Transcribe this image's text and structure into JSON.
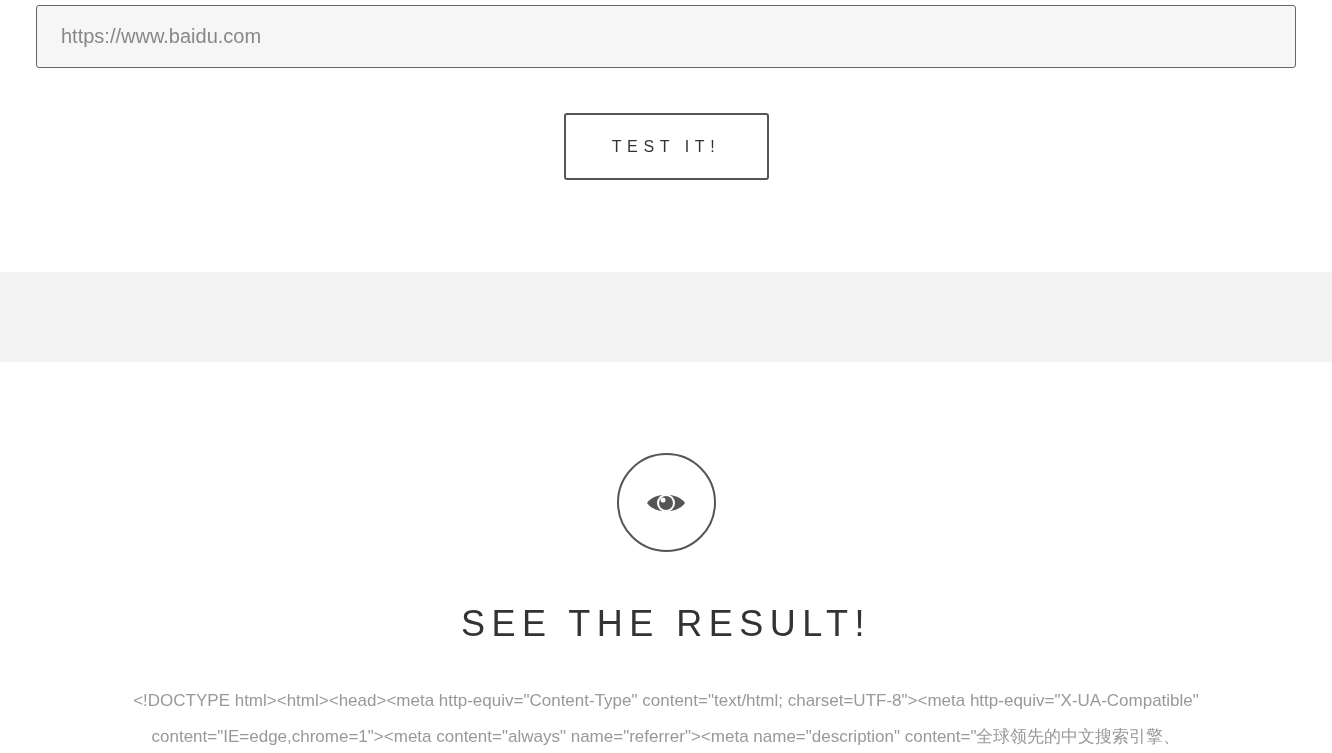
{
  "url_field": {
    "placeholder": "https://www.baidu.com"
  },
  "test_button": {
    "label": "TEST IT!"
  },
  "result": {
    "heading": "SEE THE RESULT!",
    "lines": [
      "<!DOCTYPE html><html><head><meta http-equiv=\"Content-Type\" content=\"text/html; charset=UTF-8\"><meta http-equiv=\"X-UA-Compatible\"",
      "content=\"IE=edge,chrome=1\"><meta content=\"always\" name=\"referrer\"><meta name=\"description\" content=\"全球领先的中文搜索引擎、"
    ]
  }
}
